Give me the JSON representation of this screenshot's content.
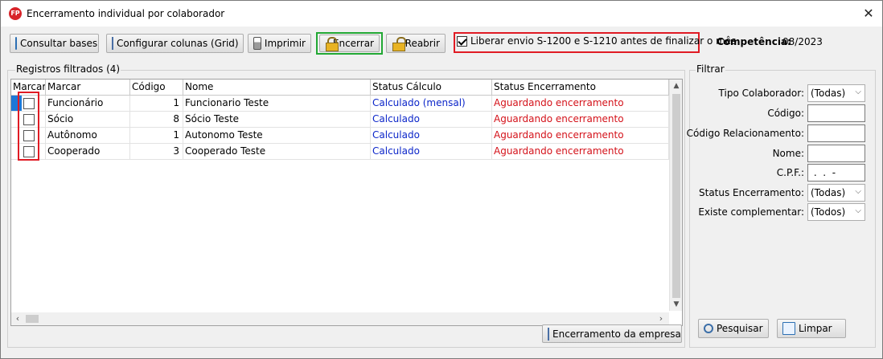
{
  "window": {
    "title": "Encerramento individual por colaborador",
    "app_icon_text": "FP",
    "close_glyph": "✕"
  },
  "toolbar": {
    "consultar_label": "Consultar bases",
    "configurar_label": "Configurar colunas (Grid)",
    "imprimir_label": "Imprimir",
    "encerrar_label": "Encerrar",
    "reabrir_label": "Reabrir",
    "liberar_label": "Liberar envio S-1200 e S-1210 antes de finalizar o mês",
    "liberar_checked": true,
    "competencia_label": "Competência:",
    "competencia_value": "08/2023"
  },
  "records": {
    "legend": "Registros filtrados (4)",
    "columns": [
      "Marcar",
      "Marcar",
      "Código",
      "Nome",
      "Status Cálculo",
      "Status Encerramento"
    ],
    "rows": [
      {
        "tipo": "Funcionário",
        "codigo": "1",
        "nome": "Funcionario Teste",
        "status_calculo": "Calculado (mensal)",
        "status_encerramento": "Aguardando encerramento",
        "checked": false
      },
      {
        "tipo": "Sócio",
        "codigo": "8",
        "nome": "Sócio Teste",
        "status_calculo": "Calculado",
        "status_encerramento": "Aguardando encerramento",
        "checked": false
      },
      {
        "tipo": "Autônomo",
        "codigo": "1",
        "nome": "Autonomo Teste",
        "status_calculo": "Calculado",
        "status_encerramento": "Aguardando encerramento",
        "checked": false
      },
      {
        "tipo": "Cooperado",
        "codigo": "3",
        "nome": "Cooperado Teste",
        "status_calculo": "Calculado",
        "status_encerramento": "Aguardando encerramento",
        "checked": false
      }
    ],
    "encerramento_empresa_label": "Encerramento da empresa"
  },
  "filter": {
    "legend": "Filtrar",
    "tipo_colaborador_label": "Tipo Colaborador:",
    "tipo_colaborador_value": "(Todas)",
    "codigo_label": "Código:",
    "codigo_value": "",
    "codigo_relacionamento_label": "Código Relacionamento:",
    "codigo_relacionamento_value": "",
    "nome_label": "Nome:",
    "nome_value": "",
    "cpf_label": "C.P.F.:",
    "cpf_value": " .  .  -",
    "status_encerramento_label": "Status Encerramento:",
    "status_encerramento_value": "(Todas)",
    "existe_complementar_label": "Existe complementar:",
    "existe_complementar_value": "(Todos)",
    "pesquisar_label": "Pesquisar",
    "limpar_label": "Limpar"
  },
  "colors": {
    "highlight_green": "#22a834",
    "highlight_red": "#e01b24",
    "status_calculo": "#0c26c9",
    "status_encerramento": "#d4121a",
    "selection": "#1e78d7"
  }
}
